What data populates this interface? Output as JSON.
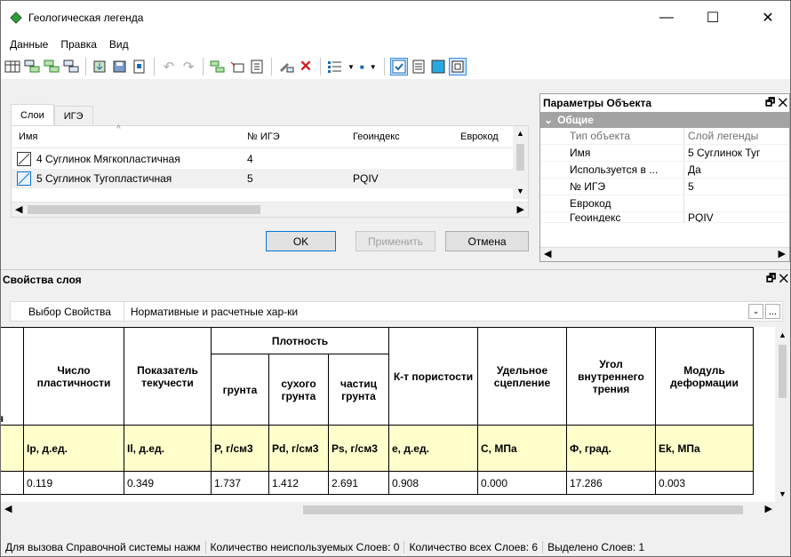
{
  "window": {
    "title": "Геологическая легенда",
    "minimize": "—",
    "maximize": "☐",
    "close": "✕"
  },
  "menu": [
    "Данные",
    "Правка",
    "Вид"
  ],
  "tabs": [
    "Слои",
    "ИГЭ"
  ],
  "layers_table": {
    "columns": [
      "Имя",
      "№ ИГЭ",
      "Геоиндекс",
      "Еврокод"
    ],
    "rows": [
      {
        "name": "4 Суглинок Мягкопластичная",
        "ige": "4",
        "geoindex": ""
      },
      {
        "name": "5 Суглинок Тугопластичная",
        "ige": "5",
        "geoindex": "PQIV"
      }
    ]
  },
  "buttons": {
    "ok": "OK",
    "apply": "Применить",
    "cancel": "Отмена"
  },
  "props": {
    "title": "Параметры Объекта",
    "group": "Общие",
    "rows": [
      {
        "k": "Тип объекта",
        "v": "Слой легенды"
      },
      {
        "k": "Имя",
        "v": "5 Суглинок Туг"
      },
      {
        "k": "Используется в ...",
        "v": "Да"
      },
      {
        "k": "№ ИГЭ",
        "v": "5"
      },
      {
        "k": "Еврокод",
        "v": ""
      },
      {
        "k": "Геоиндекс",
        "v": "PQIV"
      }
    ]
  },
  "layer_props": {
    "title": "Свойства слоя",
    "select_label": "Выбор Свойства",
    "select_value": "Нормативные и расчетные хар-ки",
    "more": "..."
  },
  "grid": {
    "density_group": "Плотность",
    "headers": [
      "Число пластичности",
      "Показатель текучести",
      "грунта",
      "сухого грунта",
      "частиц грунта",
      "К-т пористости",
      "Удельное сцепление",
      "Угол внутреннего трения",
      "Модуль деформации"
    ],
    "units": [
      "Ip, д.ед.",
      "Il, д.ед.",
      "P, г/см3",
      "Pd, г/см3",
      "Ps, г/см3",
      "e, д.ед.",
      "C, МПа",
      "Ф, град.",
      "Ek, МПа"
    ],
    "values": [
      "0.119",
      "0.349",
      "1.737",
      "1.412",
      "2.691",
      "0.908",
      "0.000",
      "17.286",
      "0.003"
    ],
    "edge_fragment": "я"
  },
  "status": [
    "Для вызова Справочной системы нажм",
    "Количество неиспользуемых Слоев: 0",
    "Количество всех Слоев: 6",
    "Выделено Слоев: 1"
  ]
}
